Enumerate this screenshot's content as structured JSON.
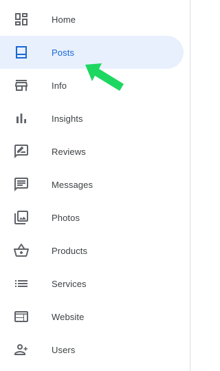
{
  "nav": {
    "items": [
      {
        "label": "Home",
        "icon": "dashboard-icon",
        "active": false
      },
      {
        "label": "Posts",
        "icon": "posts-icon",
        "active": true
      },
      {
        "label": "Info",
        "icon": "storefront-icon",
        "active": false
      },
      {
        "label": "Insights",
        "icon": "bar-chart-icon",
        "active": false
      },
      {
        "label": "Reviews",
        "icon": "rate-review-icon",
        "active": false
      },
      {
        "label": "Messages",
        "icon": "message-icon",
        "active": false
      },
      {
        "label": "Photos",
        "icon": "photo-library-icon",
        "active": false
      },
      {
        "label": "Products",
        "icon": "shopping-basket-icon",
        "active": false
      },
      {
        "label": "Services",
        "icon": "list-icon",
        "active": false
      },
      {
        "label": "Website",
        "icon": "web-icon",
        "active": false
      },
      {
        "label": "Users",
        "icon": "person-add-icon",
        "active": false
      }
    ]
  },
  "colors": {
    "active_background": "#e8f0fe",
    "active_foreground": "#1967d2",
    "icon_default": "#5f6368",
    "label_default": "#3c4043",
    "annotation_arrow": "#1ed760"
  }
}
